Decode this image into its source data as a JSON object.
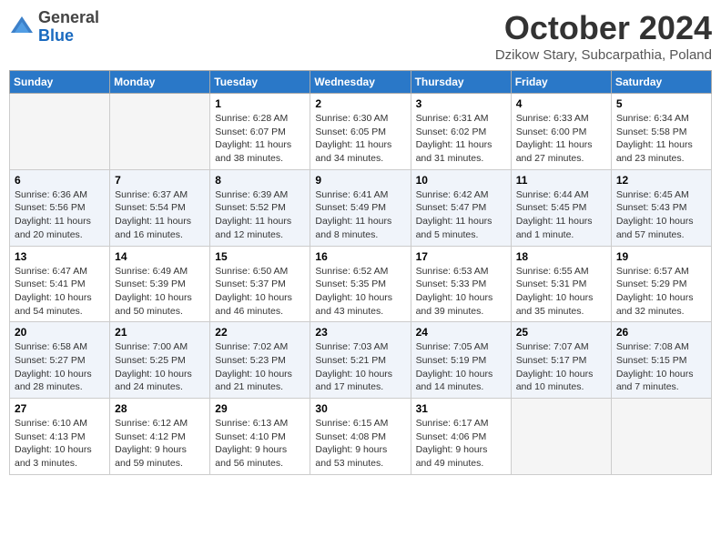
{
  "header": {
    "logo_general": "General",
    "logo_blue": "Blue",
    "month": "October 2024",
    "location": "Dzikow Stary, Subcarpathia, Poland"
  },
  "days_of_week": [
    "Sunday",
    "Monday",
    "Tuesday",
    "Wednesday",
    "Thursday",
    "Friday",
    "Saturday"
  ],
  "weeks": [
    [
      {
        "day": "",
        "info": ""
      },
      {
        "day": "",
        "info": ""
      },
      {
        "day": "1",
        "info": "Sunrise: 6:28 AM\nSunset: 6:07 PM\nDaylight: 11 hours and 38 minutes."
      },
      {
        "day": "2",
        "info": "Sunrise: 6:30 AM\nSunset: 6:05 PM\nDaylight: 11 hours and 34 minutes."
      },
      {
        "day": "3",
        "info": "Sunrise: 6:31 AM\nSunset: 6:02 PM\nDaylight: 11 hours and 31 minutes."
      },
      {
        "day": "4",
        "info": "Sunrise: 6:33 AM\nSunset: 6:00 PM\nDaylight: 11 hours and 27 minutes."
      },
      {
        "day": "5",
        "info": "Sunrise: 6:34 AM\nSunset: 5:58 PM\nDaylight: 11 hours and 23 minutes."
      }
    ],
    [
      {
        "day": "6",
        "info": "Sunrise: 6:36 AM\nSunset: 5:56 PM\nDaylight: 11 hours and 20 minutes."
      },
      {
        "day": "7",
        "info": "Sunrise: 6:37 AM\nSunset: 5:54 PM\nDaylight: 11 hours and 16 minutes."
      },
      {
        "day": "8",
        "info": "Sunrise: 6:39 AM\nSunset: 5:52 PM\nDaylight: 11 hours and 12 minutes."
      },
      {
        "day": "9",
        "info": "Sunrise: 6:41 AM\nSunset: 5:49 PM\nDaylight: 11 hours and 8 minutes."
      },
      {
        "day": "10",
        "info": "Sunrise: 6:42 AM\nSunset: 5:47 PM\nDaylight: 11 hours and 5 minutes."
      },
      {
        "day": "11",
        "info": "Sunrise: 6:44 AM\nSunset: 5:45 PM\nDaylight: 11 hours and 1 minute."
      },
      {
        "day": "12",
        "info": "Sunrise: 6:45 AM\nSunset: 5:43 PM\nDaylight: 10 hours and 57 minutes."
      }
    ],
    [
      {
        "day": "13",
        "info": "Sunrise: 6:47 AM\nSunset: 5:41 PM\nDaylight: 10 hours and 54 minutes."
      },
      {
        "day": "14",
        "info": "Sunrise: 6:49 AM\nSunset: 5:39 PM\nDaylight: 10 hours and 50 minutes."
      },
      {
        "day": "15",
        "info": "Sunrise: 6:50 AM\nSunset: 5:37 PM\nDaylight: 10 hours and 46 minutes."
      },
      {
        "day": "16",
        "info": "Sunrise: 6:52 AM\nSunset: 5:35 PM\nDaylight: 10 hours and 43 minutes."
      },
      {
        "day": "17",
        "info": "Sunrise: 6:53 AM\nSunset: 5:33 PM\nDaylight: 10 hours and 39 minutes."
      },
      {
        "day": "18",
        "info": "Sunrise: 6:55 AM\nSunset: 5:31 PM\nDaylight: 10 hours and 35 minutes."
      },
      {
        "day": "19",
        "info": "Sunrise: 6:57 AM\nSunset: 5:29 PM\nDaylight: 10 hours and 32 minutes."
      }
    ],
    [
      {
        "day": "20",
        "info": "Sunrise: 6:58 AM\nSunset: 5:27 PM\nDaylight: 10 hours and 28 minutes."
      },
      {
        "day": "21",
        "info": "Sunrise: 7:00 AM\nSunset: 5:25 PM\nDaylight: 10 hours and 24 minutes."
      },
      {
        "day": "22",
        "info": "Sunrise: 7:02 AM\nSunset: 5:23 PM\nDaylight: 10 hours and 21 minutes."
      },
      {
        "day": "23",
        "info": "Sunrise: 7:03 AM\nSunset: 5:21 PM\nDaylight: 10 hours and 17 minutes."
      },
      {
        "day": "24",
        "info": "Sunrise: 7:05 AM\nSunset: 5:19 PM\nDaylight: 10 hours and 14 minutes."
      },
      {
        "day": "25",
        "info": "Sunrise: 7:07 AM\nSunset: 5:17 PM\nDaylight: 10 hours and 10 minutes."
      },
      {
        "day": "26",
        "info": "Sunrise: 7:08 AM\nSunset: 5:15 PM\nDaylight: 10 hours and 7 minutes."
      }
    ],
    [
      {
        "day": "27",
        "info": "Sunrise: 6:10 AM\nSunset: 4:13 PM\nDaylight: 10 hours and 3 minutes."
      },
      {
        "day": "28",
        "info": "Sunrise: 6:12 AM\nSunset: 4:12 PM\nDaylight: 9 hours and 59 minutes."
      },
      {
        "day": "29",
        "info": "Sunrise: 6:13 AM\nSunset: 4:10 PM\nDaylight: 9 hours and 56 minutes."
      },
      {
        "day": "30",
        "info": "Sunrise: 6:15 AM\nSunset: 4:08 PM\nDaylight: 9 hours and 53 minutes."
      },
      {
        "day": "31",
        "info": "Sunrise: 6:17 AM\nSunset: 4:06 PM\nDaylight: 9 hours and 49 minutes."
      },
      {
        "day": "",
        "info": ""
      },
      {
        "day": "",
        "info": ""
      }
    ]
  ]
}
